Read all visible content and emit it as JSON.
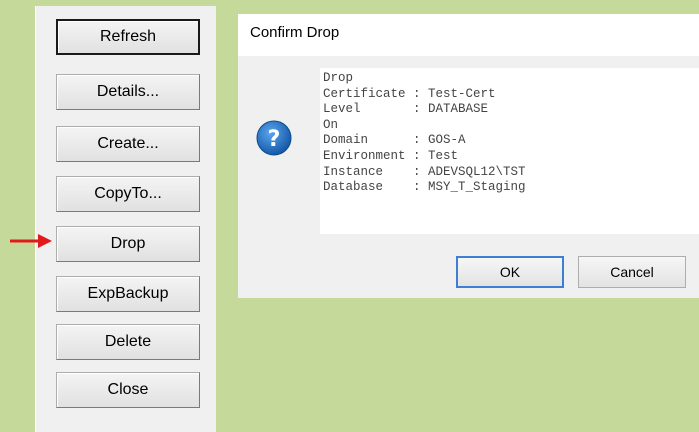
{
  "colors": {
    "background": "#c5d99a",
    "panel": "#f0f0f0",
    "arrow": "#e01b1b",
    "icon_blue": "#1e6fc2"
  },
  "left_panel": {
    "buttons": [
      {
        "label": "Refresh",
        "default": true
      },
      {
        "label": "Details..."
      },
      {
        "label": "Create..."
      },
      {
        "label": "CopyTo..."
      },
      {
        "label": "Drop",
        "highlighted_by_arrow": true
      },
      {
        "label": "ExpBackup"
      },
      {
        "label": "Delete"
      },
      {
        "label": "Close"
      }
    ]
  },
  "dialog": {
    "title": "Confirm Drop",
    "icon": "question-icon",
    "message_lines": [
      "Drop",
      "Certificate : Test-Cert",
      "Level       : DATABASE",
      "On",
      "Domain      : GOS-A",
      "Environment : Test",
      "Instance    : ADEVSQL12\\TST",
      "Database    : MSY_T_Staging"
    ],
    "ok_label": "OK",
    "cancel_label": "Cancel"
  }
}
